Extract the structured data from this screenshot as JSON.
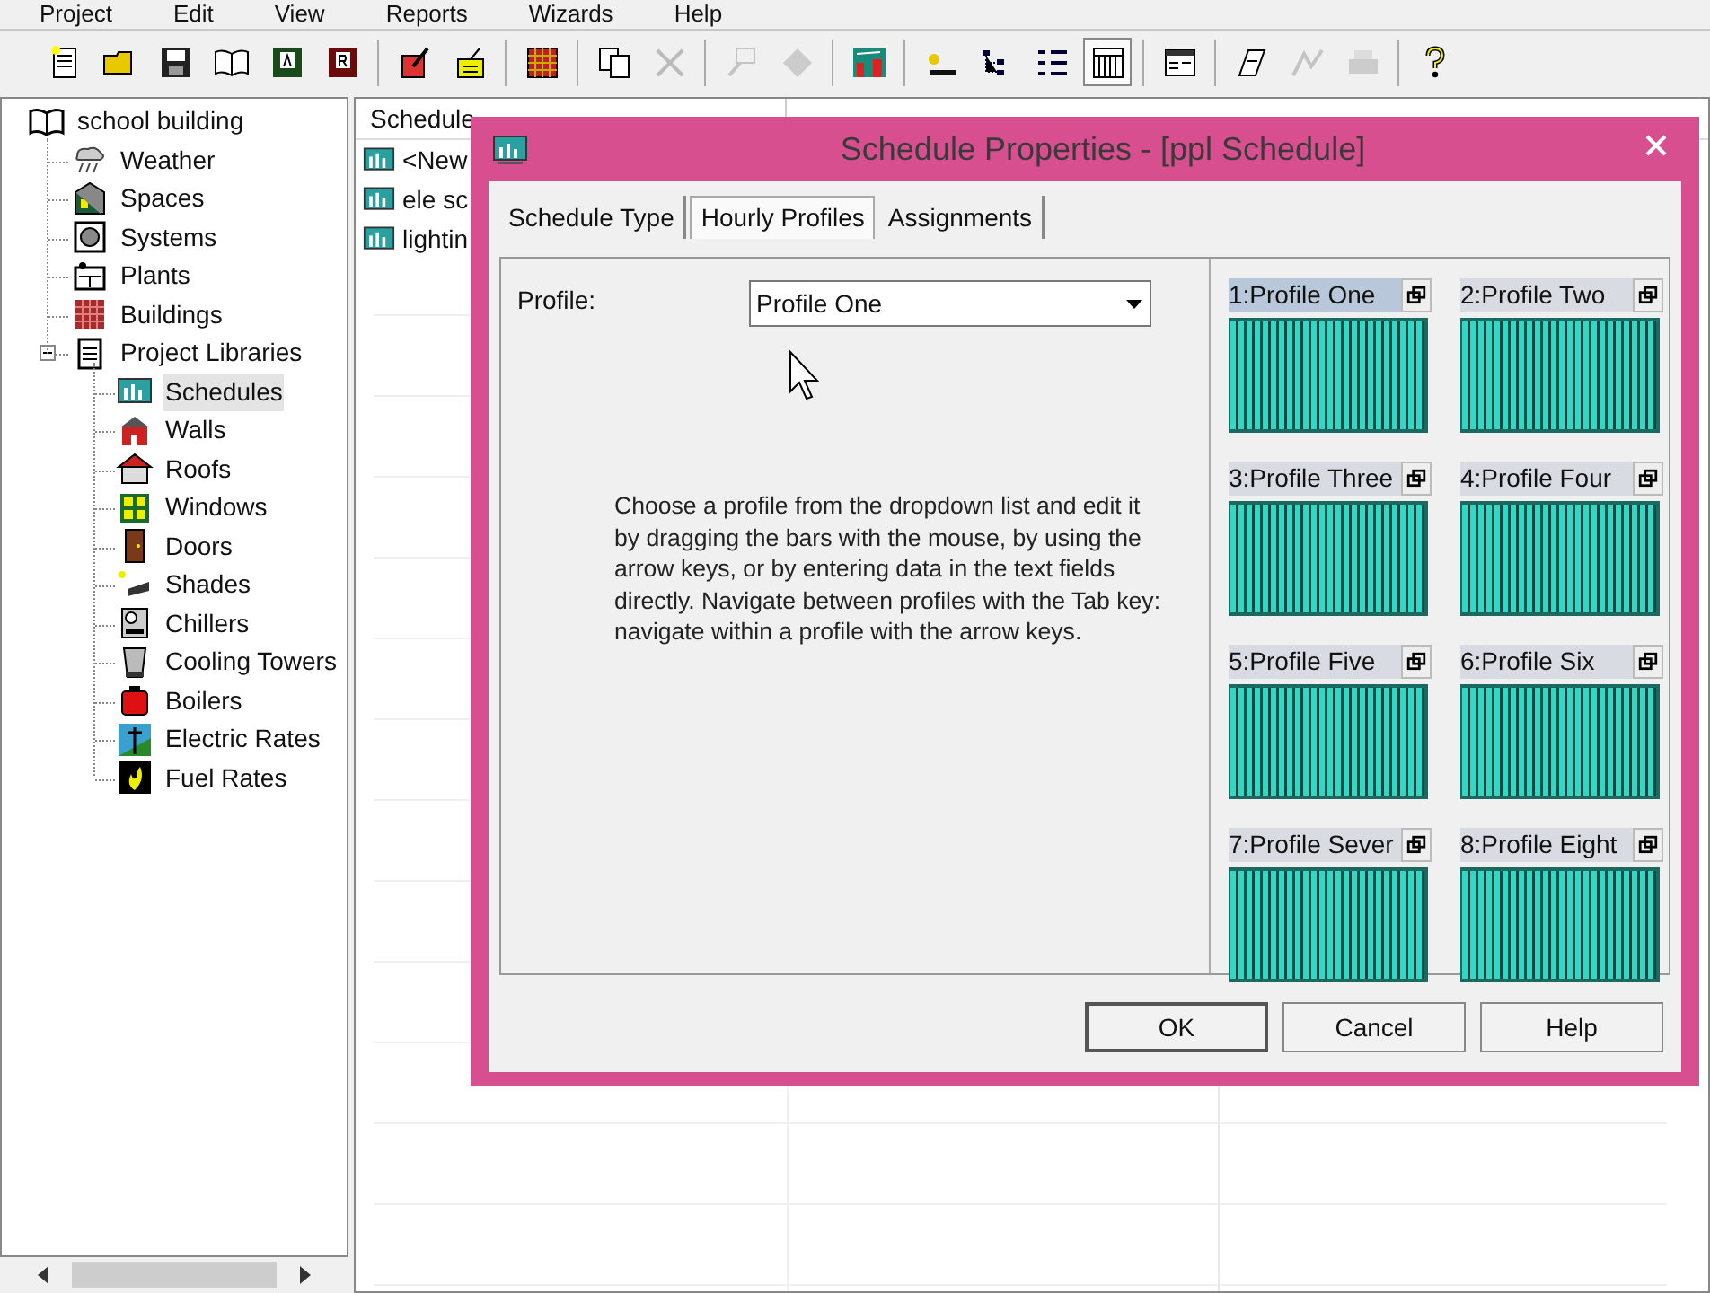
{
  "menu": [
    "Project",
    "Edit",
    "View",
    "Reports",
    "Wizards",
    "Help"
  ],
  "toolbar": [
    {
      "disabled": false,
      "pressed": false
    },
    {
      "disabled": false,
      "pressed": false
    },
    {
      "disabled": false,
      "pressed": false
    },
    {
      "disabled": false,
      "pressed": false
    },
    {
      "disabled": false,
      "pressed": false
    },
    {
      "disabled": false,
      "pressed": false
    },
    {
      "disabled": false,
      "pressed": false
    },
    {
      "disabled": false,
      "pressed": false
    },
    {
      "disabled": false,
      "pressed": false
    },
    {
      "disabled": false,
      "pressed": false
    },
    {
      "disabled": true,
      "pressed": false
    },
    {
      "disabled": true,
      "pressed": false
    },
    {
      "disabled": true,
      "pressed": false
    },
    {
      "disabled": false,
      "pressed": false
    },
    {
      "disabled": false,
      "pressed": false
    },
    {
      "disabled": false,
      "pressed": false
    },
    {
      "disabled": false,
      "pressed": false
    },
    {
      "disabled": false,
      "pressed": true
    },
    {
      "disabled": false,
      "pressed": false
    },
    {
      "disabled": false,
      "pressed": false
    },
    {
      "disabled": true,
      "pressed": false
    },
    {
      "disabled": true,
      "pressed": false
    },
    {
      "disabled": false,
      "pressed": false
    }
  ],
  "tree": {
    "label": "school building",
    "selected": false,
    "children": [
      {
        "label": "Weather",
        "selected": false
      },
      {
        "label": "Spaces",
        "selected": false
      },
      {
        "label": "Systems",
        "selected": false
      },
      {
        "label": "Plants",
        "selected": false
      },
      {
        "label": "Buildings",
        "selected": false
      },
      {
        "label": "Project Libraries",
        "selected": false,
        "expanded": true,
        "children": [
          {
            "label": "Schedules",
            "selected": true
          },
          {
            "label": "Walls",
            "selected": false
          },
          {
            "label": "Roofs",
            "selected": false
          },
          {
            "label": "Windows",
            "selected": false
          },
          {
            "label": "Doors",
            "selected": false
          },
          {
            "label": "Shades",
            "selected": false
          },
          {
            "label": "Chillers",
            "selected": false
          },
          {
            "label": "Cooling Towers",
            "selected": false
          },
          {
            "label": "Boilers",
            "selected": false
          },
          {
            "label": "Electric Rates",
            "selected": false
          },
          {
            "label": "Fuel Rates",
            "selected": false
          }
        ]
      }
    ]
  },
  "list": {
    "columns": [
      "Schedule"
    ],
    "rows": [
      "<New",
      "ele sc",
      "lightin"
    ]
  },
  "dialog": {
    "title": "Schedule Properties - [ppl Schedule]",
    "tabs": [
      {
        "label": "Schedule Type",
        "selected": false
      },
      {
        "label": "Hourly Profiles",
        "selected": true
      },
      {
        "label": "Assignments",
        "selected": false
      }
    ],
    "profile_label": "Profile:",
    "profile_select": {
      "value": "Profile One"
    },
    "instructions": "Choose a profile from the dropdown list and edit it by dragging the bars with the mouse, by using the arrow keys, or by entering data in the text fields directly.  Navigate between profiles with the Tab key: navigate within a profile with the arrow keys.",
    "profiles": [
      {
        "label": "1:Profile One",
        "selected": true
      },
      {
        "label": "2:Profile Two",
        "selected": false
      },
      {
        "label": "3:Profile Three",
        "selected": false
      },
      {
        "label": "4:Profile Four",
        "selected": false
      },
      {
        "label": "5:Profile Five",
        "selected": false
      },
      {
        "label": "6:Profile Six",
        "selected": false
      },
      {
        "label": "7:Profile Sever",
        "selected": false
      },
      {
        "label": "8:Profile Eight",
        "selected": false
      }
    ],
    "buttons": [
      "OK",
      "Cancel",
      "Help"
    ]
  }
}
